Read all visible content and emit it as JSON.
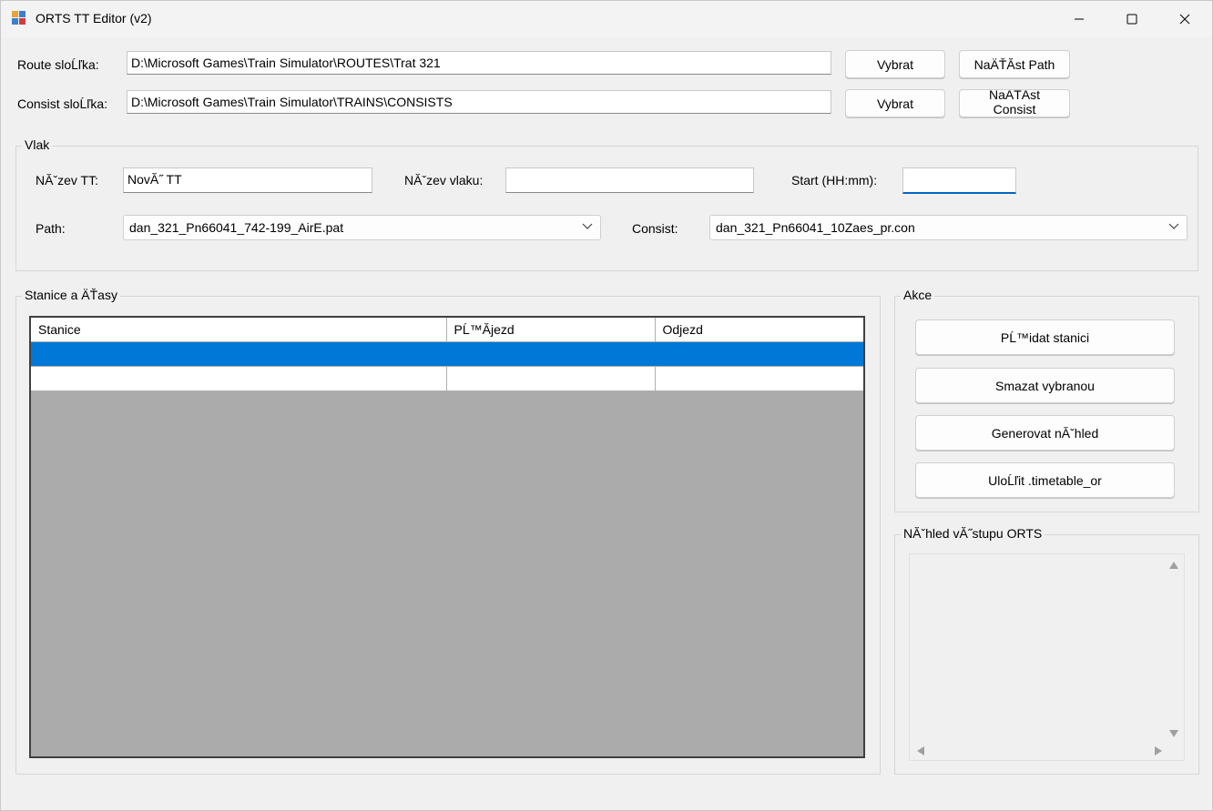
{
  "window": {
    "title": "ORTS TT Editor (v2)"
  },
  "paths": {
    "route_label": "Route sloĹľka:",
    "route_value": "D:\\Microsoft Games\\Train Simulator\\ROUTES\\Trat 321",
    "consist_label": "Consist sloĹľka:",
    "consist_value": "D:\\Microsoft Games\\Train Simulator\\TRAINS\\CONSISTS",
    "select_route_button": "Vybrat",
    "load_path_button": "NaÄŤĂst Path",
    "select_consist_button": "Vybrat",
    "load_consist_button": "NaÄŤĂst Consist"
  },
  "train": {
    "group_title": "Vlak",
    "tt_name_label": "NĂˇzev TT:",
    "tt_name_value": "NovĂ˝ TT",
    "train_name_label": "NĂˇzev vlaku:",
    "train_name_value": "",
    "start_label": "Start (HH:mm):",
    "start_value": "",
    "path_label": "Path:",
    "path_value": "dan_321_Pn66041_742-199_AirE.pat",
    "consist_label": "Consist:",
    "consist_value": "dan_321_Pn66041_10Zaes_pr.con"
  },
  "stations": {
    "group_title": "Stanice a ÄŤasy",
    "columns": [
      "Stanice",
      "PĹ™Ă­jezd",
      "Odjezd"
    ],
    "rows": [
      {
        "station": "",
        "arrival": "",
        "departure": "",
        "selected": true
      },
      {
        "station": "",
        "arrival": "",
        "departure": "",
        "selected": false
      }
    ]
  },
  "actions": {
    "group_title": "Akce",
    "add_station": "PĹ™idat stanici",
    "delete_selected": "Smazat vybranou",
    "generate_preview": "Generovat nĂˇhled",
    "save_timetable": "UloĹľit .timetable_or"
  },
  "preview": {
    "group_title": "NĂˇhled vĂ˝stupu ORTS",
    "content": ""
  },
  "colors": {
    "selection": "#0078d7",
    "focus_underline": "#0067c0",
    "grid_background": "#ababab"
  },
  "icons": {
    "app": "app-icon",
    "minimize": "minimize-icon",
    "maximize": "maximize-icon",
    "close": "close-icon",
    "dropdown": "chevron-down-icon"
  }
}
